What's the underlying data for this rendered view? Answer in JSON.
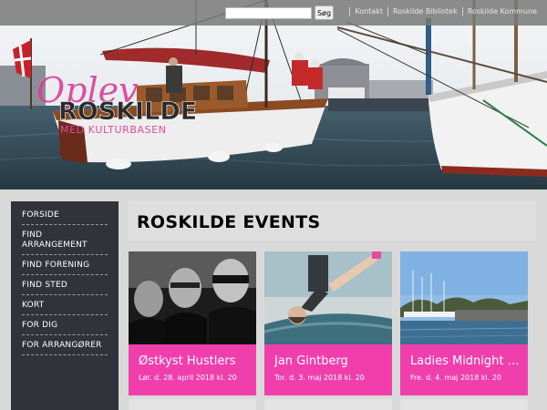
{
  "header": {
    "logo_script": "Oplev",
    "logo_main": "ROSKILDE",
    "logo_sub": "MED KULTURBASEN",
    "search": {
      "placeholder": "",
      "value": "",
      "button_label": "Søg"
    },
    "top_links": [
      "Kontakt",
      "Roskilde Bibliotek",
      "Roskilde Kommune"
    ]
  },
  "sidebar": {
    "items": [
      {
        "label": "FORSIDE"
      },
      {
        "label": "FIND ARRANGEMENT"
      },
      {
        "label": "FIND FORENING"
      },
      {
        "label": "FIND STED"
      },
      {
        "label": "KORT"
      },
      {
        "label": "FOR DIG"
      },
      {
        "label": "FOR ARRANGØRER"
      }
    ]
  },
  "main": {
    "title": "ROSKILDE EVENTS",
    "cards": [
      {
        "title": "Østkyst Hustlers",
        "date": "Lør. d. 28. april 2018 kl. 20"
      },
      {
        "title": "Jan Gintberg",
        "date": "Tor. d. 3. maj 2018 kl. 20"
      },
      {
        "title": "Ladies Midnight Run",
        "date": "Fre. d. 4. maj 2018 kl. 20"
      }
    ]
  },
  "colors": {
    "accent_pink": "#f03fac",
    "sidebar_bg": "#30333a",
    "page_bg": "#d9d9d9"
  }
}
